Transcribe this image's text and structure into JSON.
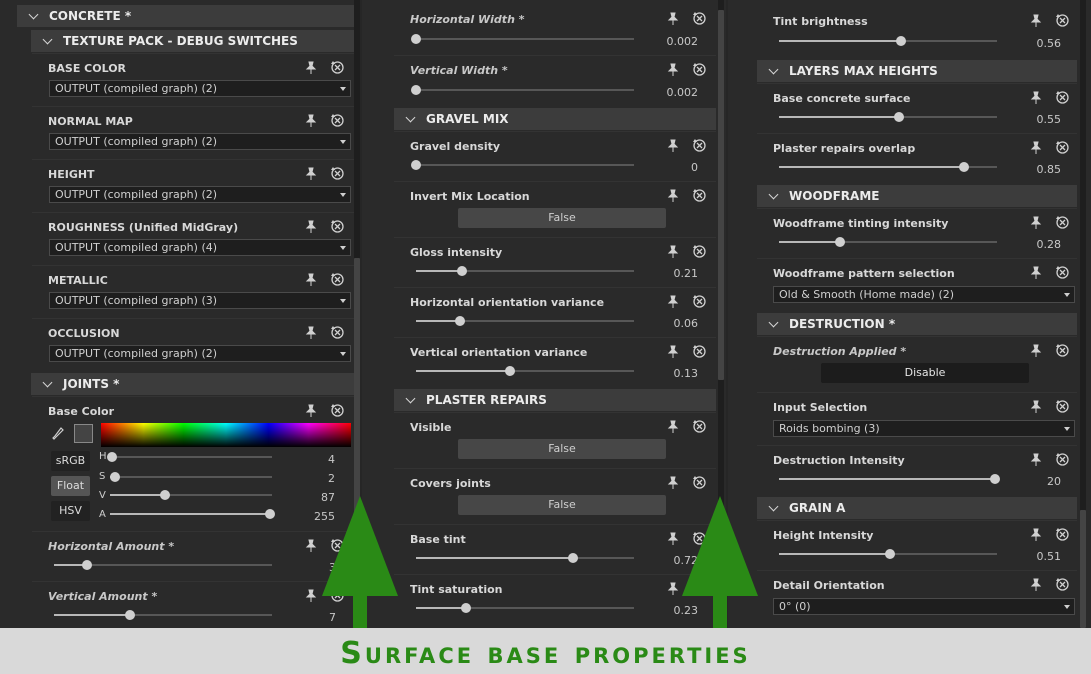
{
  "colors": {
    "accent_green": "#2a8a16",
    "banner_bg": "#d9d9d9",
    "panel_bg": "#2a2a2a"
  },
  "icons": {
    "pin": "pin-icon",
    "reset": "reset-icon",
    "chevron": "chevron-down-icon",
    "eyedropper": "eyedropper-icon"
  },
  "col1": {
    "concrete_header": "CONCRETE *",
    "texture_pack_header": "TEXTURE PACK - DEBUG SWITCHES",
    "base_color": {
      "label": "BASE COLOR",
      "value": "OUTPUT (compiled graph) (2)"
    },
    "normal_map": {
      "label": "NORMAL MAP",
      "value": "OUTPUT (compiled graph) (2)"
    },
    "height": {
      "label": "HEIGHT",
      "value": "OUTPUT  (compiled graph) (2)"
    },
    "roughness": {
      "label": "ROUGHNESS (Unified MidGray)",
      "value": "OUTPUT  (compiled graph) (4)"
    },
    "metallic": {
      "label": "METALLIC",
      "value": "OUTPUT  (compiled graph) (3)"
    },
    "occlusion": {
      "label": "OCCLUSION",
      "value": "OUTPUT  (compiled graph) (2)"
    },
    "joints_header": "JOINTS *",
    "joints_base_color": {
      "label": "Base Color",
      "modes": [
        "sRGB",
        "Float",
        "HSV"
      ],
      "active_mode": "Float",
      "h": {
        "label": "H",
        "value": "4"
      },
      "s": {
        "label": "S",
        "value": "2"
      },
      "v": {
        "label": "V",
        "value": "87"
      },
      "a": {
        "label": "A",
        "value": "255"
      }
    },
    "horizontal_amount": {
      "label": "Horizontal Amount *",
      "value": "3"
    },
    "vertical_amount": {
      "label": "Vertical Amount *",
      "value": "7"
    }
  },
  "col2": {
    "horizontal_width": {
      "label": "Horizontal Width *",
      "value": "0.002"
    },
    "vertical_width": {
      "label": "Vertical Width *",
      "value": "0.002"
    },
    "gravel_mix_header": "GRAVEL MIX",
    "gravel_density": {
      "label": "Gravel density",
      "value": "0"
    },
    "invert_mix_location": {
      "label": "Invert Mix Location",
      "value": "False"
    },
    "gloss_intensity": {
      "label": "Gloss intensity",
      "value": "0.21"
    },
    "horizontal_orientation_variance": {
      "label": "Horizontal orientation variance",
      "value": "0.06"
    },
    "vertical_orientation_variance": {
      "label": "Vertical orientation variance",
      "value": "0.13"
    },
    "plaster_repairs_header": "PLASTER REPAIRS",
    "visible": {
      "label": "Visible",
      "value": "False"
    },
    "covers_joints": {
      "label": "Covers joints",
      "value": "False"
    },
    "base_tint": {
      "label": "Base tint",
      "value": "0.72"
    },
    "tint_saturation": {
      "label": "Tint saturation",
      "value": "0.23"
    }
  },
  "col3": {
    "tint_brightness": {
      "label": "Tint brightness",
      "value": "0.56"
    },
    "layers_max_heights_header": "LAYERS MAX HEIGHTS",
    "base_concrete_surface": {
      "label": "Base concrete surface",
      "value": "0.55"
    },
    "plaster_repairs_overlap": {
      "label": "Plaster repairs overlap",
      "value": "0.85"
    },
    "woodframe_header": "WOODFRAME",
    "woodframe_tinting_intensity": {
      "label": "Woodframe tinting intensity",
      "value": "0.28"
    },
    "woodframe_pattern_selection": {
      "label": "Woodframe pattern selection",
      "value": "Old & Smooth (Home made) (2)"
    },
    "destruction_header": "DESTRUCTION *",
    "destruction_applied": {
      "label": "Destruction Applied *",
      "value": "Disable"
    },
    "input_selection": {
      "label": "Input Selection",
      "value": "Roids bombing (3)"
    },
    "destruction_intensity": {
      "label": "Destruction Intensity",
      "value": "20"
    },
    "grain_a_header": "GRAIN A",
    "height_intensity": {
      "label": "Height Intensity",
      "value": "0.51"
    },
    "detail_orientation": {
      "label": "Detail Orientation",
      "value": "0° (0)"
    }
  },
  "banner": {
    "text": "Surface base properties"
  }
}
